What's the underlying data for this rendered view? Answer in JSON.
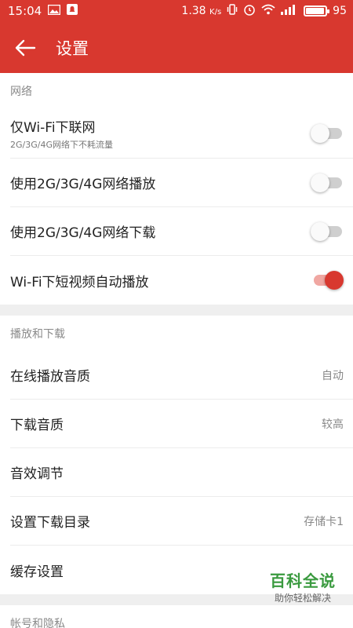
{
  "status_bar": {
    "time": "15:04",
    "network_speed": "1.38",
    "network_speed_unit": "K/s",
    "battery_level": 95
  },
  "app_bar": {
    "title": "设置"
  },
  "sections": {
    "network": {
      "header": "网络",
      "wifi_only": {
        "label": "仅Wi-Fi下联网",
        "sub": "2G/3G/4G网络下不耗流量",
        "on": false
      },
      "mobile_play": {
        "label": "使用2G/3G/4G网络播放",
        "on": false
      },
      "mobile_download": {
        "label": "使用2G/3G/4G网络下载",
        "on": false
      },
      "wifi_autoplay": {
        "label": "Wi-Fi下短视频自动播放",
        "on": true
      }
    },
    "play_download": {
      "header": "播放和下载",
      "online_quality": {
        "label": "在线播放音质",
        "value": "自动"
      },
      "download_quality": {
        "label": "下载音质",
        "value": "较高"
      },
      "sound_effect": {
        "label": "音效调节"
      },
      "download_dir": {
        "label": "设置下载目录",
        "value": "存储卡1"
      },
      "cache": {
        "label": "缓存设置"
      }
    },
    "account": {
      "header": "帐号和隐私"
    }
  },
  "watermark": {
    "title": "百科全说",
    "subtitle": "助你轻松解决"
  },
  "colors": {
    "accent": "#d8382f",
    "toggle_on_track": "#f0a7a2",
    "watermark_green": "#3a9a3f"
  }
}
